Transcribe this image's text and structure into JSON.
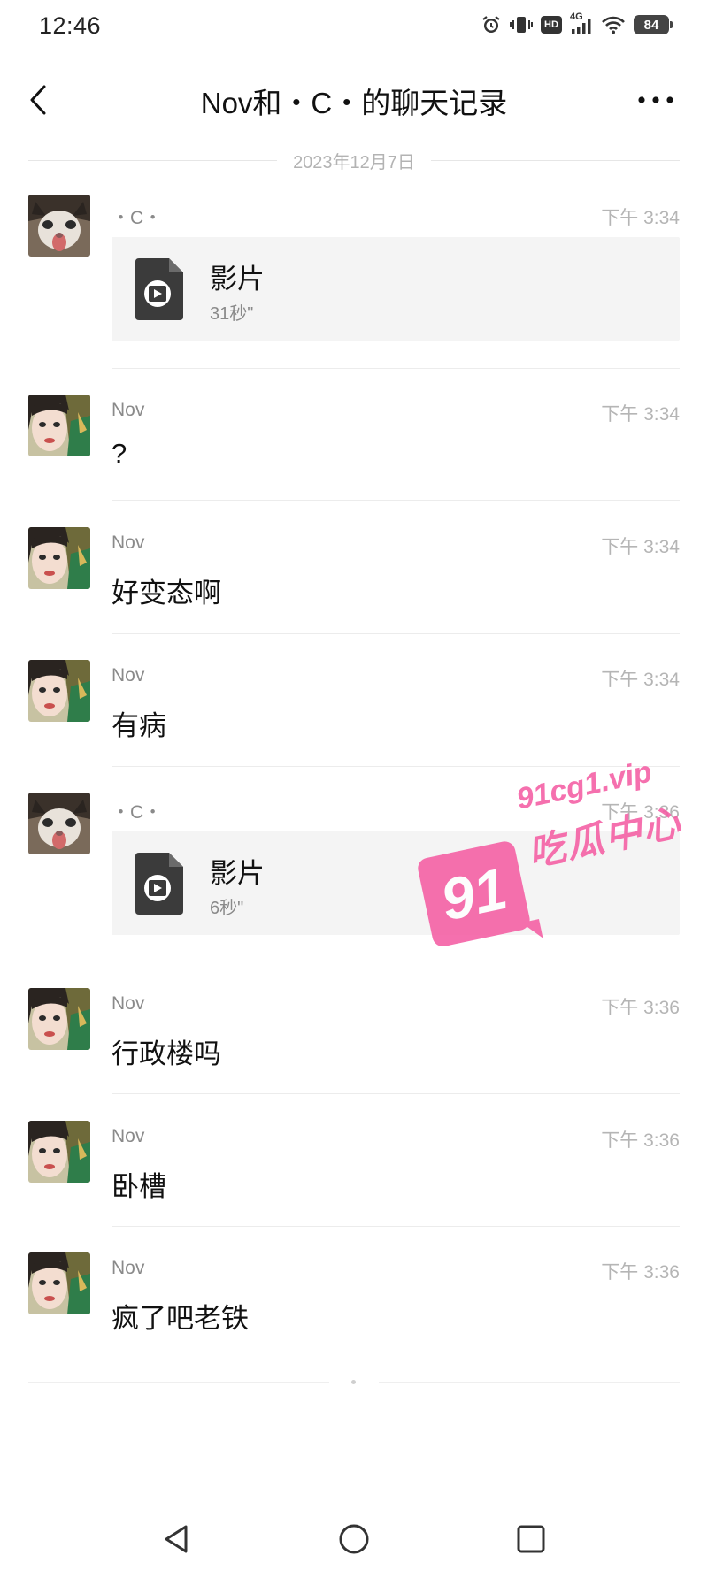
{
  "status_bar": {
    "time": "12:46",
    "hd_label": "HD",
    "network_label": "4G",
    "battery": "84"
  },
  "header": {
    "title": "Nov和・C・的聊天记录"
  },
  "date_divider": "2023年12月7日",
  "messages": [
    {
      "sender": "・C・",
      "time": "下午 3:34",
      "type": "file",
      "file_name": "影片",
      "duration": "31秒\""
    },
    {
      "sender": "Nov",
      "time": "下午 3:34",
      "type": "text",
      "text": "?"
    },
    {
      "sender": "Nov",
      "time": "下午 3:34",
      "type": "text",
      "text": "好变态啊"
    },
    {
      "sender": "Nov",
      "time": "下午 3:34",
      "type": "text",
      "text": "有病"
    },
    {
      "sender": "・C・",
      "time": "下午 3:36",
      "type": "file",
      "file_name": "影片",
      "duration": "6秒\""
    },
    {
      "sender": "Nov",
      "time": "下午 3:36",
      "type": "text",
      "text": "行政楼吗"
    },
    {
      "sender": "Nov",
      "time": "下午 3:36",
      "type": "text",
      "text": "卧槽"
    },
    {
      "sender": "Nov",
      "time": "下午 3:36",
      "type": "text",
      "text": "疯了吧老铁"
    }
  ],
  "watermark": {
    "badge": "91",
    "url": "91cg1.vip",
    "name": "吃瓜中心"
  },
  "colors": {
    "background": "#ffffff",
    "file_card": "#f4f4f4",
    "secondary_text": "#8a8a8a",
    "watermark": "#f45da3"
  },
  "icons": {
    "back": "chevron-left-icon",
    "more": "more-dots-icon",
    "file": "video-file-icon",
    "nav_back": "triangle-back-icon",
    "nav_home": "circle-home-icon",
    "nav_recents": "square-recents-icon"
  }
}
